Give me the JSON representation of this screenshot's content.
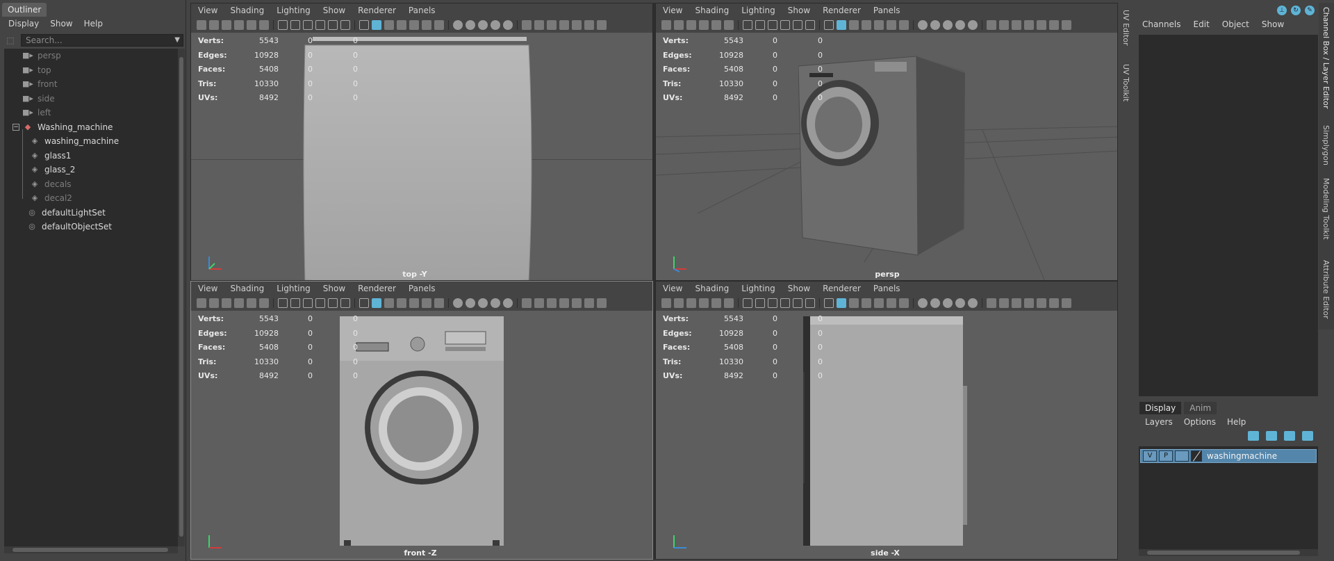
{
  "outliner": {
    "tab": "Outliner",
    "menu": [
      "Display",
      "Show",
      "Help"
    ],
    "search_placeholder": "Search...",
    "items": [
      {
        "label": "persp",
        "icon": "camera-icon",
        "dim": true
      },
      {
        "label": "top",
        "icon": "camera-icon",
        "dim": true
      },
      {
        "label": "front",
        "icon": "camera-icon",
        "dim": true
      },
      {
        "label": "side",
        "icon": "camera-icon",
        "dim": true
      },
      {
        "label": "left",
        "icon": "camera-icon",
        "dim": true
      },
      {
        "label": "Washing_machine",
        "icon": "group-icon",
        "dim": false
      },
      {
        "label": "washing_machine",
        "icon": "mesh-icon",
        "dim": false
      },
      {
        "label": "glass1",
        "icon": "mesh-icon",
        "dim": false
      },
      {
        "label": "glass_2",
        "icon": "mesh-icon",
        "dim": false
      },
      {
        "label": "decals",
        "icon": "mesh-icon",
        "dim": true
      },
      {
        "label": "decal2",
        "icon": "mesh-icon",
        "dim": true
      },
      {
        "label": "defaultLightSet",
        "icon": "set-icon",
        "dim": false
      },
      {
        "label": "defaultObjectSet",
        "icon": "set-icon",
        "dim": false
      }
    ]
  },
  "viewport_menu": [
    "View",
    "Shading",
    "Lighting",
    "Show",
    "Renderer",
    "Panels"
  ],
  "stats": {
    "labels": [
      "Verts:",
      "Edges:",
      "Faces:",
      "Tris:",
      "UVs:"
    ],
    "values": [
      "5543",
      "10928",
      "5408",
      "10330",
      "8492"
    ],
    "zeros": [
      "0",
      "0",
      "0",
      "0",
      "0"
    ]
  },
  "viewports": {
    "top": "top -Y",
    "persp": "persp",
    "front": "front -Z",
    "side": "side -X"
  },
  "side_tabs_left": [
    "UV Editor",
    "UV Toolkit"
  ],
  "side_tabs_right": [
    "Channel Box / Layer Editor",
    "Simplygon",
    "Modeling Toolkit",
    "Attribute Editor"
  ],
  "channel_box": {
    "menu": [
      "Channels",
      "Edit",
      "Object",
      "Show"
    ]
  },
  "layer_editor": {
    "tabs": [
      "Display",
      "Anim"
    ],
    "menu": [
      "Layers",
      "Options",
      "Help"
    ],
    "layer": {
      "v": "V",
      "p": "P",
      "name": "washingmachine"
    }
  },
  "colors": {
    "accent": "#5fb4d6",
    "layer_selected": "#5486ab"
  }
}
